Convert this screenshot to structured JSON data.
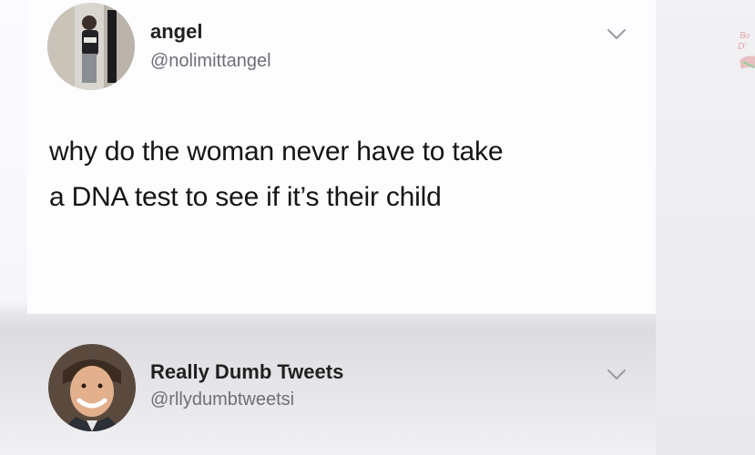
{
  "tweet": {
    "author_name": "angel",
    "author_handle": "@nolimittangel",
    "text_line_1": "why do the woman never have to take",
    "text_line_2": "a DNA test to see if it’s their child",
    "avatar_icon": "profile-photo-icon",
    "menu_icon": "chevron-down-icon"
  },
  "attribution": {
    "author_name": "Really Dumb Tweets",
    "author_handle": "@rllydumbtweetsi",
    "avatar_icon": "profile-photo-icon",
    "menu_icon": "chevron-down-icon"
  },
  "colors": {
    "text": "#151515",
    "handle": "#6f6f74",
    "chevron": "#9a9aa0",
    "background": "#fdfcfe"
  }
}
